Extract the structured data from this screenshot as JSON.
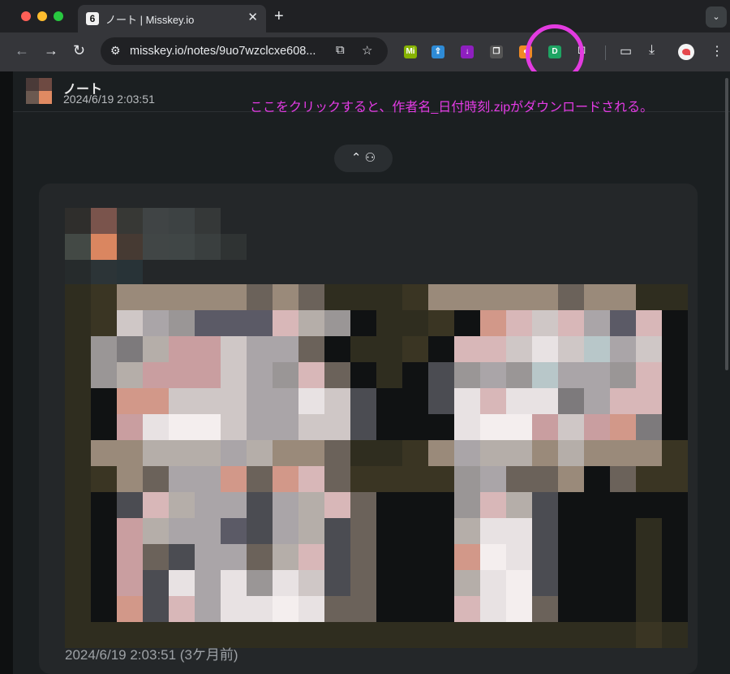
{
  "browser": {
    "tab_title": "ノート | Misskey.io",
    "tab_favicon": "6",
    "url": "misskey.io/notes/9uo7wzclcxe608...",
    "new_tab": "+",
    "close_tab": "✕",
    "tab_search": "⌄",
    "extensions": [
      {
        "name": "misskey-extension-icon",
        "label": "Mi",
        "color": "#86b300"
      },
      {
        "name": "share-extension-icon",
        "label": "⇪",
        "color": "#2e8bd6"
      },
      {
        "name": "download-extension-icon",
        "label": "↓",
        "color": "#8e1fbf"
      },
      {
        "name": "bookmark-extension-icon",
        "label": "❐",
        "color": "#555"
      },
      {
        "name": "shield-extension-icon",
        "label": "●",
        "color": "#f08a24"
      },
      {
        "name": "note-downloader-extension-icon",
        "label": "D",
        "color": "#1ea463"
      }
    ]
  },
  "note": {
    "header_title": "ノート",
    "header_date": "2024/6/19 2:03:51",
    "footer_date": "2024/6/19 2:03:51 (3ケ月前)"
  },
  "annotation": "ここをクリックすると、作者名_日付時刻.zipがダウンロードされる。",
  "toggle": {
    "label": "⌃ ⚇"
  },
  "colors": {
    "annotation": "#e43be5",
    "page_bg": "#1b1f21",
    "chrome_bg": "#35363a"
  }
}
